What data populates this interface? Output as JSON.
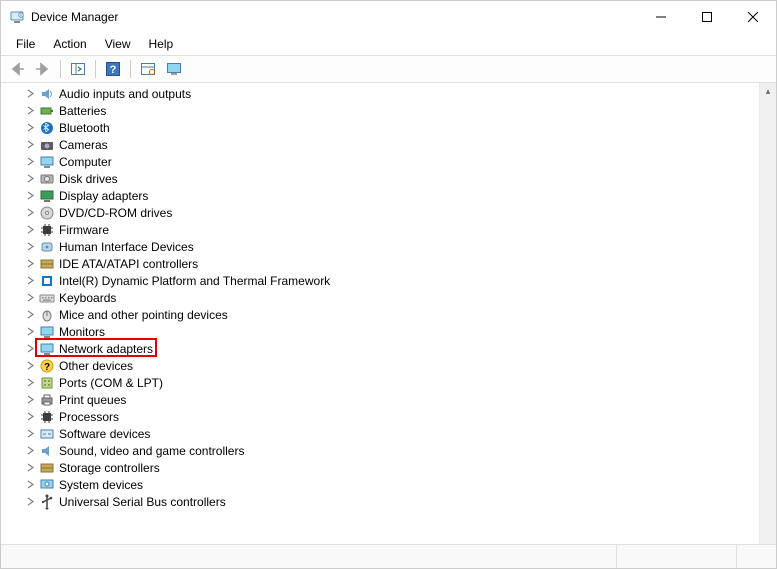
{
  "window": {
    "title": "Device Manager"
  },
  "menubar": {
    "items": [
      "File",
      "Action",
      "View",
      "Help"
    ]
  },
  "tree": {
    "nodes": [
      {
        "label": "Audio inputs and outputs",
        "icon": "speaker"
      },
      {
        "label": "Batteries",
        "icon": "battery"
      },
      {
        "label": "Bluetooth",
        "icon": "bluetooth"
      },
      {
        "label": "Cameras",
        "icon": "camera"
      },
      {
        "label": "Computer",
        "icon": "computer"
      },
      {
        "label": "Disk drives",
        "icon": "disk"
      },
      {
        "label": "Display adapters",
        "icon": "display"
      },
      {
        "label": "DVD/CD-ROM drives",
        "icon": "optical"
      },
      {
        "label": "Firmware",
        "icon": "chip"
      },
      {
        "label": "Human Interface Devices",
        "icon": "hid"
      },
      {
        "label": "IDE ATA/ATAPI controllers",
        "icon": "ide"
      },
      {
        "label": "Intel(R) Dynamic Platform and Thermal Framework",
        "icon": "intel"
      },
      {
        "label": "Keyboards",
        "icon": "keyboard"
      },
      {
        "label": "Mice and other pointing devices",
        "icon": "mouse"
      },
      {
        "label": "Monitors",
        "icon": "monitor"
      },
      {
        "label": "Network adapters",
        "icon": "network",
        "highlighted": true
      },
      {
        "label": "Other devices",
        "icon": "warning"
      },
      {
        "label": "Ports (COM & LPT)",
        "icon": "port"
      },
      {
        "label": "Print queues",
        "icon": "printer"
      },
      {
        "label": "Processors",
        "icon": "cpu"
      },
      {
        "label": "Software devices",
        "icon": "software"
      },
      {
        "label": "Sound, video and game controllers",
        "icon": "sound"
      },
      {
        "label": "Storage controllers",
        "icon": "storage"
      },
      {
        "label": "System devices",
        "icon": "system"
      },
      {
        "label": "Universal Serial Bus controllers",
        "icon": "usb"
      }
    ]
  }
}
